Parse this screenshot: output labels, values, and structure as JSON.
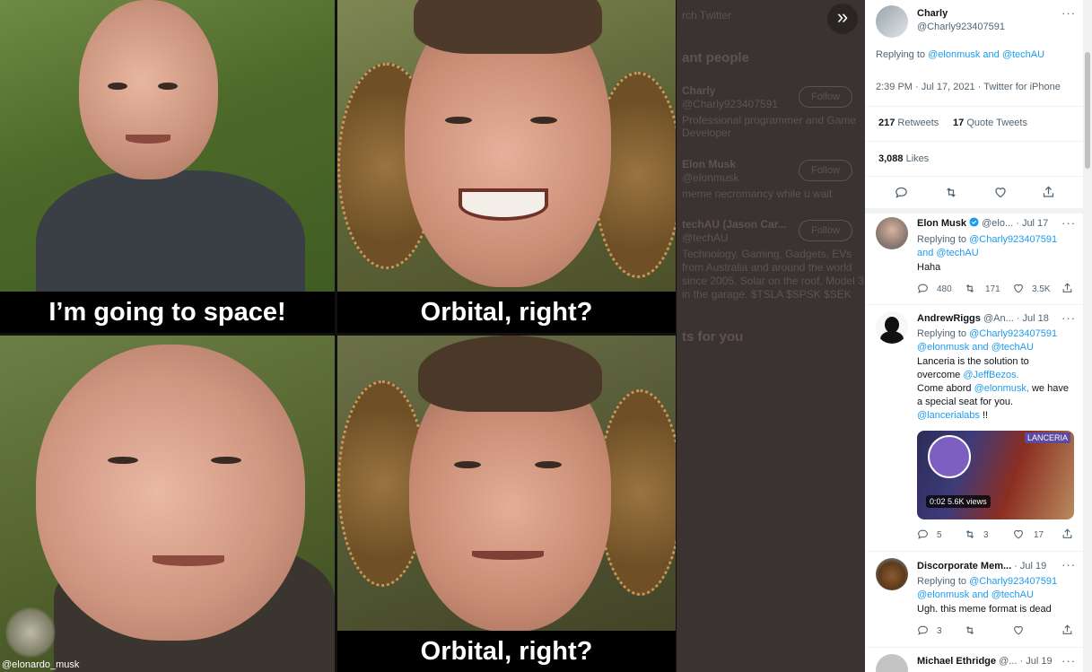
{
  "viewer": {
    "expand_glyph": "»",
    "captions": [
      "I’m going to space!",
      "Orbital, right?",
      "Orbital, right?"
    ],
    "watermark": "@elonardo_musk",
    "backdrop": {
      "search": "rch Twitter",
      "relevant_heading": "ant people",
      "people": [
        {
          "name": "Charly",
          "handle": "@Charly923407591",
          "follow": "Follow",
          "bio1": "Professional programmer and Game",
          "bio2": "Developer"
        },
        {
          "name": "Elon Musk",
          "handle": "@elonmusk",
          "follow": "Follow",
          "bio1": "meme necromancy while u wait"
        },
        {
          "name": "techAU (Jason Car...",
          "handle": "@techAU",
          "follow": "Follow",
          "bio1": "Technology, Gaming, Gadgets, EVs",
          "bio2": "from Australia and around the world",
          "bio3": "since 2005. Solar on the roof, Model 3",
          "bio4": "in the garage. $TSLA $SPSK $SEK"
        }
      ],
      "trends_heading": "ts for you"
    }
  },
  "main_tweet": {
    "name": "Charly",
    "handle": "@Charly923407591",
    "more": "···",
    "replying_prefix": "Replying to",
    "replying_users": "@elonmusk and @techAU",
    "timestamp": "2:39 PM · Jul 17, 2021 · Twitter for iPhone",
    "retweets_count": "217",
    "retweets_label": "Retweets",
    "quotes_count": "17",
    "quotes_label": "Quote Tweets",
    "likes_count": "3,088",
    "likes_label": "Likes"
  },
  "replies": [
    {
      "name": "Elon Musk",
      "handle": "@elo...",
      "date": "· Jul 17",
      "verified": true,
      "replying_prefix": "Replying to",
      "replying_line1": "@Charly923407591",
      "replying_line2": "and @techAU",
      "text": "Haha",
      "reply_count": "480",
      "retweet_count": "171",
      "like_count": "3.5K"
    },
    {
      "name": "AndrewRiggs",
      "handle": "@An...",
      "date": "· Jul 18",
      "replying_prefix": "Replying to",
      "replying_line1": "@Charly923407591",
      "replying_line2": "@elonmusk and @techAU",
      "text_line1": "Lanceria is the solution to",
      "text_line2_pre": "overcome",
      "text_line2_link": "@JeffBezos.",
      "text_line3_pre": "Come abord",
      "text_line3_link": "@elonmusk,",
      "text_line3_post": "we have",
      "text_line4": "a special seat for you.",
      "text_line5_link": "@lancerialabs",
      "text_line5_post": "!!",
      "media_time": "0:02",
      "media_views": "5.6K views",
      "media_logo": "LANCERIA",
      "reply_count": "5",
      "retweet_count": "3",
      "like_count": "17"
    },
    {
      "name": "Discorporate Mem...",
      "handle": "",
      "date": "· Jul 19",
      "replying_prefix": "Replying to",
      "replying_line1": "@Charly923407591",
      "replying_line2": "@elonmusk and @techAU",
      "text": "Ugh. this meme format is dead",
      "reply_count": "3",
      "retweet_count": "",
      "like_count": ""
    },
    {
      "name": "Michael Ethridge",
      "handle": "@...",
      "date": "· Jul 19"
    }
  ],
  "icons": {
    "reply": "reply-icon",
    "retweet": "retweet-icon",
    "like": "heart-icon",
    "share": "share-icon",
    "verified": "verified-badge-icon"
  },
  "colors": {
    "accent": "#1d9bf0",
    "muted": "#536471",
    "viewer_bg": "#3a3331"
  }
}
